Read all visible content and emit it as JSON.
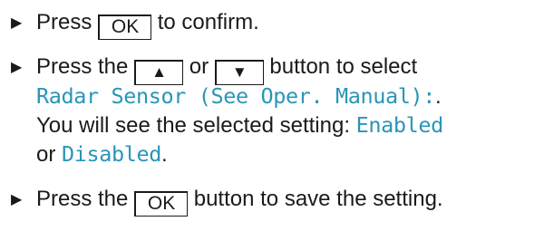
{
  "steps": [
    {
      "press": "Press",
      "key": "OK",
      "suffix": "to confirm."
    },
    {
      "press": "Press the",
      "key_up": "▲",
      "or": "or",
      "key_down": "▼",
      "suffix": "button to select",
      "display_setting": "Radar Sensor (See Oper. Manual):",
      "setting_end": ".",
      "see_text": "You will see the selected setting:",
      "option_enabled": "Enabled",
      "or2": "or",
      "option_disabled": "Disabled",
      "end": "."
    },
    {
      "press": "Press the",
      "key": "OK",
      "suffix": "button to save the setting."
    }
  ],
  "bullet_glyph": "▶",
  "colors": {
    "text": "#1a1a1a",
    "display_text": "#2a95b8"
  }
}
